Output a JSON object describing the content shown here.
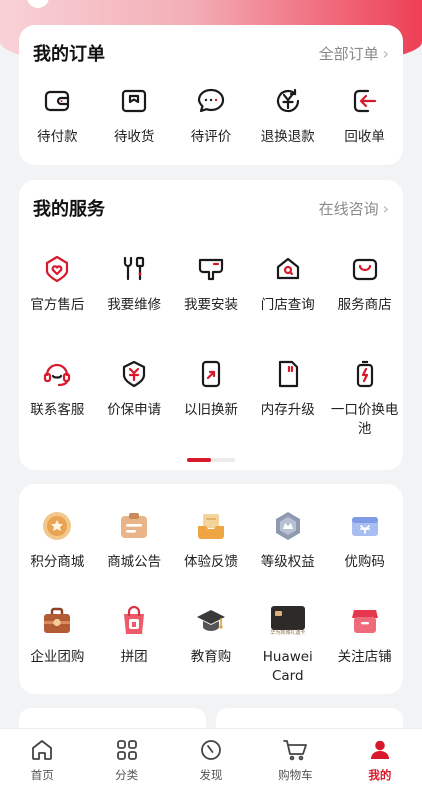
{
  "colors": {
    "accent": "#d8182b",
    "icon_stroke": "#1a1a1a",
    "background": "#f1f3f5"
  },
  "orders": {
    "title": "我的订单",
    "all_link": "全部订单",
    "items": [
      {
        "label": "待付款",
        "icon": "wallet-icon"
      },
      {
        "label": "待收货",
        "icon": "package-icon"
      },
      {
        "label": "待评价",
        "icon": "comment-icon"
      },
      {
        "label": "退换退款",
        "icon": "refund-icon"
      },
      {
        "label": "回收单",
        "icon": "recycle-icon"
      }
    ]
  },
  "services": {
    "title": "我的服务",
    "consult_link": "在线咨询",
    "row1": [
      {
        "label": "官方售后",
        "icon": "shield-heart-icon"
      },
      {
        "label": "我要维修",
        "icon": "wrench-icon"
      },
      {
        "label": "我要安装",
        "icon": "install-icon"
      },
      {
        "label": "门店查询",
        "icon": "store-search-icon"
      },
      {
        "label": "服务商店",
        "icon": "service-store-icon"
      }
    ],
    "row2": [
      {
        "label": "联系客服",
        "icon": "headset-icon"
      },
      {
        "label": "价保申请",
        "icon": "price-protect-icon"
      },
      {
        "label": "以旧换新",
        "icon": "trade-in-icon"
      },
      {
        "label": "内存升级",
        "icon": "memory-card-icon"
      },
      {
        "label": "一口价换电池",
        "icon": "battery-icon"
      }
    ]
  },
  "promos": {
    "row1": [
      {
        "label": "积分商城",
        "icon": "points-coin-icon"
      },
      {
        "label": "商城公告",
        "icon": "announcement-icon"
      },
      {
        "label": "体验反馈",
        "icon": "feedback-tray-icon"
      },
      {
        "label": "等级权益",
        "icon": "level-badge-icon"
      },
      {
        "label": "优购码",
        "icon": "coupon-code-icon"
      }
    ],
    "row2": [
      {
        "label": "企业团购",
        "icon": "enterprise-bag-icon"
      },
      {
        "label": "拼团",
        "icon": "group-buy-icon"
      },
      {
        "label": "教育购",
        "icon": "graduation-cap-icon"
      },
      {
        "label": "Huawei Card",
        "icon": "huawei-card-icon",
        "card_text": "华为商城礼遇卡"
      },
      {
        "label": "关注店铺",
        "icon": "follow-store-icon"
      }
    ]
  },
  "tabbar": [
    {
      "label": "首页",
      "icon": "home-icon"
    },
    {
      "label": "分类",
      "icon": "category-icon"
    },
    {
      "label": "发现",
      "icon": "compass-icon"
    },
    {
      "label": "购物车",
      "icon": "cart-icon"
    },
    {
      "label": "我的",
      "icon": "profile-icon",
      "active": true
    }
  ]
}
